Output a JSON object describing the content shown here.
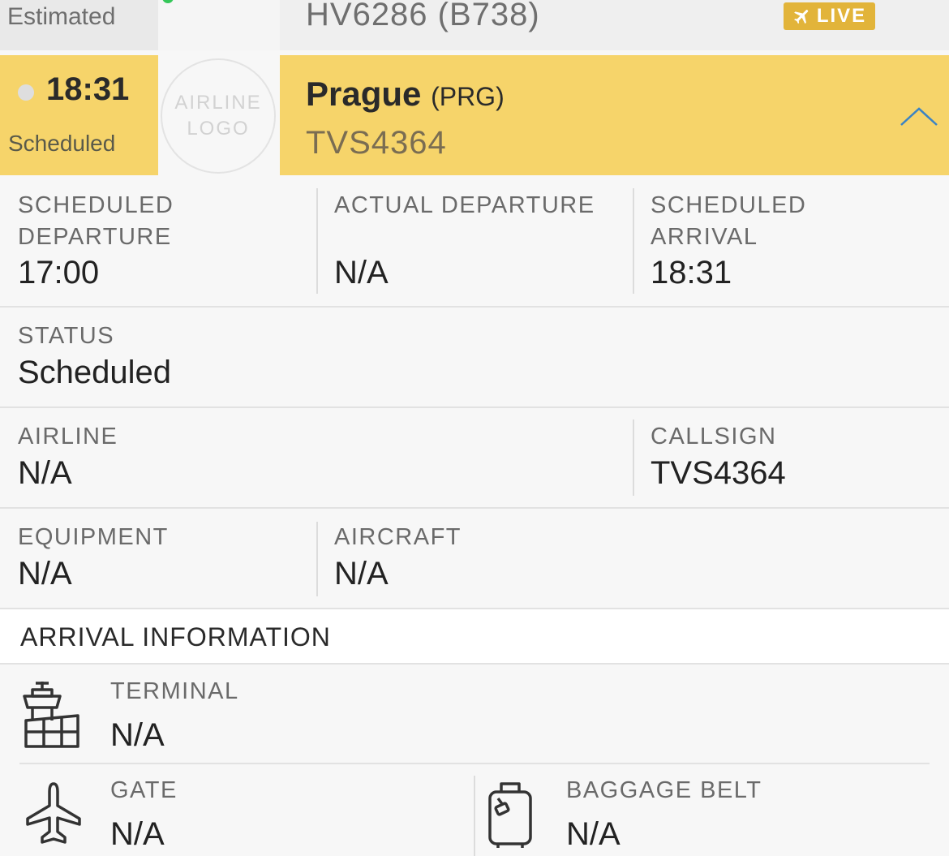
{
  "previous_flight": {
    "status": "Estimated",
    "flight": "HV6286 (B738)",
    "live_label": "LIVE"
  },
  "selected_flight": {
    "time": "18:31",
    "status": "Scheduled",
    "logo_line1": "AIRLINE",
    "logo_line2": "LOGO",
    "destination": "Prague",
    "destination_code": "(PRG)",
    "callsign": "TVS4364"
  },
  "details": {
    "scheduled_departure_label": "SCHEDULED DEPARTURE",
    "scheduled_departure_value": "17:00",
    "actual_departure_label": "ACTUAL DEPARTURE",
    "actual_departure_value": "N/A",
    "scheduled_arrival_label": "SCHEDULED ARRIVAL",
    "scheduled_arrival_value": "18:31",
    "status_label": "STATUS",
    "status_value": "Scheduled",
    "airline_label": "AIRLINE",
    "airline_value": "N/A",
    "callsign_label": "CALLSIGN",
    "callsign_value": "TVS4364",
    "equipment_label": "EQUIPMENT",
    "equipment_value": "N/A",
    "aircraft_label": "AIRCRAFT",
    "aircraft_value": "N/A"
  },
  "arrival_info": {
    "heading": "ARRIVAL INFORMATION",
    "terminal_label": "TERMINAL",
    "terminal_value": "N/A",
    "gate_label": "GATE",
    "gate_value": "N/A",
    "baggage_label": "BAGGAGE BELT",
    "baggage_value": "N/A"
  },
  "icons": {
    "live": "airplane-icon",
    "collapse": "chevron-up-icon",
    "terminal": "control-tower-icon",
    "gate": "airplane-icon",
    "baggage": "luggage-icon"
  },
  "colors": {
    "selected_row": "#f6d46a",
    "live_badge": "#e2b43a",
    "live_dot": "#35c759"
  }
}
